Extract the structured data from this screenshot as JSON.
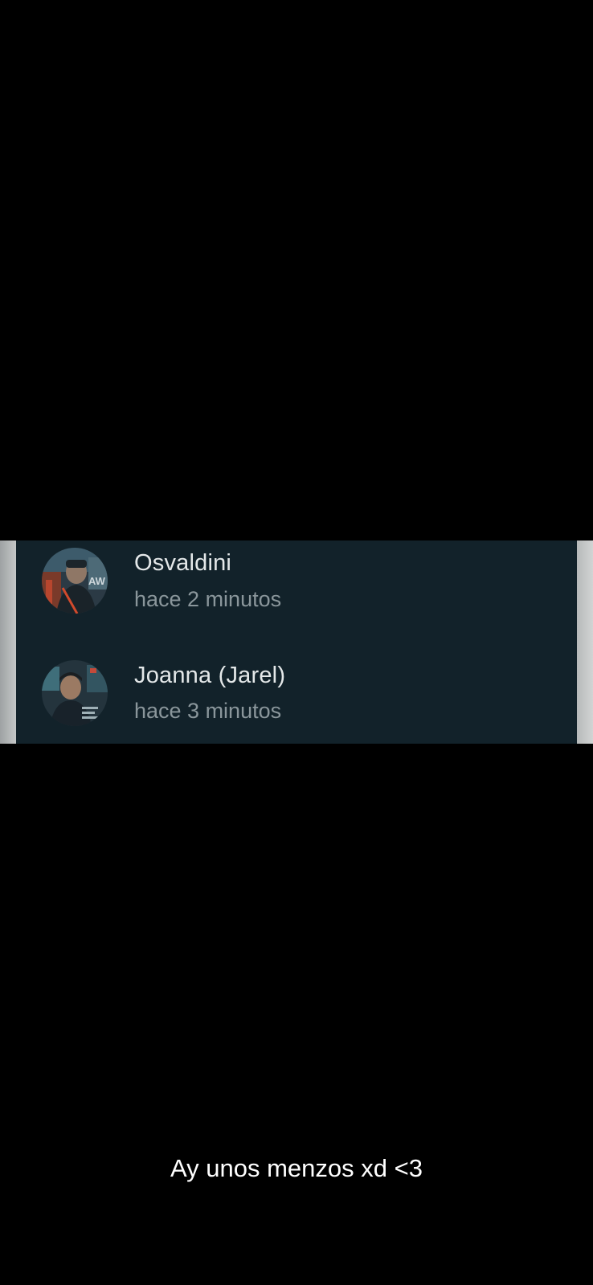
{
  "viewers": [
    {
      "name": "Osvaldini",
      "time": "hace 2 minutos",
      "avatar_icon": "profile-photo"
    },
    {
      "name": "Joanna (Jarel)",
      "time": "hace 3 minutos",
      "avatar_icon": "profile-photo"
    }
  ],
  "caption": "Ay unos menzos xd <3",
  "colors": {
    "background": "#000000",
    "list_background": "#12222a",
    "name_text": "#e4e8e9",
    "time_text": "#8a969b",
    "caption_text": "#ffffff"
  }
}
